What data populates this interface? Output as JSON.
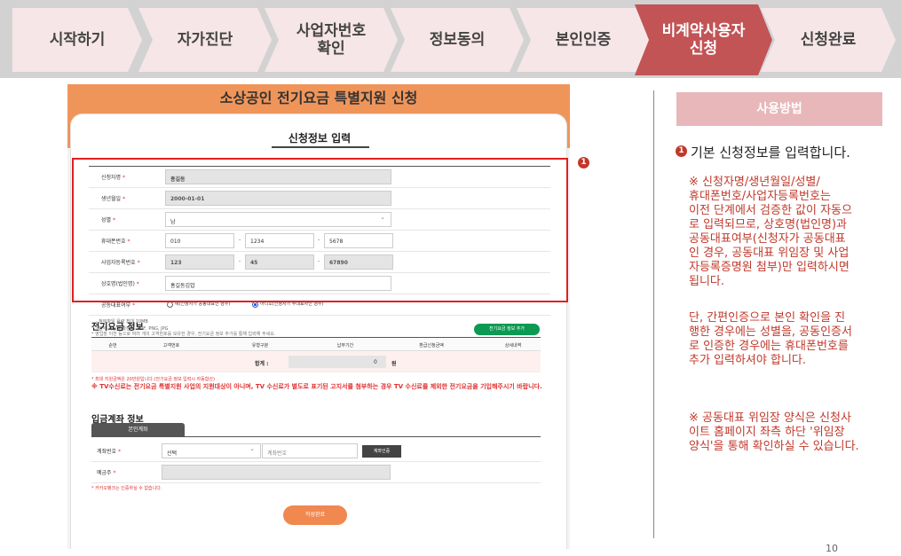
{
  "steps": [
    {
      "label": "시작하기"
    },
    {
      "label": "자가진단"
    },
    {
      "label": "사업자번호\n확인"
    },
    {
      "label": "정보동의"
    },
    {
      "label": "본인인증"
    },
    {
      "label": "비계약사용자\n신청",
      "active": true
    },
    {
      "label": "신청완료"
    }
  ],
  "screen": {
    "header_title": "소상공인 전기요금 특별지원 신청",
    "card_title": "신청정보 입력",
    "form": {
      "applicant_name": {
        "label": "신청자명",
        "value": "홍길동"
      },
      "birth_date": {
        "label": "생년월일",
        "value": "2000-01-01"
      },
      "gender": {
        "label": "성별",
        "value": "남"
      },
      "phone": {
        "label": "휴대폰번호",
        "part1": "010",
        "part2": "1234",
        "part3": "5678"
      },
      "biz_number": {
        "label": "사업자등록번호",
        "part1": "123",
        "part2": "45",
        "part3": "67890"
      },
      "company_name": {
        "label": "상호명(법인명)",
        "value": "홍길동김밥"
      },
      "joint_rep": {
        "label": "공동대표여부",
        "option_yes": "예(신청자가 공동대표인 경우)",
        "option_no": "아니오(신청자가 주대표자인 경우)"
      },
      "required_mark": "*",
      "dash": "-"
    },
    "attach_note_1": "· 첨부파일 용량 최대 10MB",
    "attach_note_2": "· 첨부 가능한 확장자: PDF, PNG, JPG",
    "bill": {
      "title": "전기요금 정보",
      "subtitle": "* 영업장 이전 등으로 여러 개의 고객번호를 보유한 경우, 전기요금 정보 추가를 통해 입력해 주세요.",
      "add_button": "전기요금 정보 추가",
      "columns": [
        "순번",
        "고객번호",
        "유형구분",
        "납부기간",
        "환급신청금액",
        "상세내역"
      ],
      "total_label": "합계 :",
      "total_value": "0",
      "total_unit": "원",
      "max_note": "* 최대 지원금액은 20만원입니다.(전기요금 정보 입력시 자동합산)",
      "tv_note": "※ TV수신료는 전기요금 특별지원 사업의 지원대상이 아니며, TV 수신료가 별도로 표기된 고지서를 첨부하는 경우 TV 수신료를 제외한 전기요금을 기입해주시기 바랍니다."
    },
    "account": {
      "title": "입금계좌 정보",
      "tab": "본인계좌",
      "number_label": "계좌번호",
      "select_placeholder": "선택",
      "number_placeholder": "계좌번호",
      "verify_button": "계좌인증",
      "holder_label": "예금주",
      "kakao_note": "* 카카오뱅크는 인증하실 수 없습니다."
    },
    "submit_button": "작성완료"
  },
  "badge_number": "1",
  "panel": {
    "title": "사용방법",
    "desc": "기본 신청정보를 입력합니다.",
    "note1": "※ 신청자명/생년월일/성별/\n휴대폰번호/사업자등록번호는\n이전 단계에서 검증한 값이 자동으\n로 입력되므로, 상호명(법인명)과\n공동대표여부(신청자가 공동대표\n인 경우, 공동대표 위임장 및 사업\n자등록증명원 첨부)만 입력하시면\n됩니다.",
    "note2": "단, 간편인증으로 본인 확인을 진\n행한 경우에는 성별을, 공동인증서\n로 인증한 경우에는 휴대폰번호를\n추가 입력하셔야 합니다.",
    "note3": "※ 공동대표 위임장 양식은 신청사\n이트 홈페이지 좌측 하단 '위임장\n양식'을 통해 확인하실 수 있습니다."
  },
  "page_number": "10",
  "colors": {
    "active_step": "#c25456",
    "inactive_step": "#f7e6e7",
    "header_orange": "#f0955a",
    "highlight_red": "#e02020",
    "note_red": "#c0392b",
    "panel_head": "#e8b7ba",
    "green_button": "#0c9a52"
  }
}
